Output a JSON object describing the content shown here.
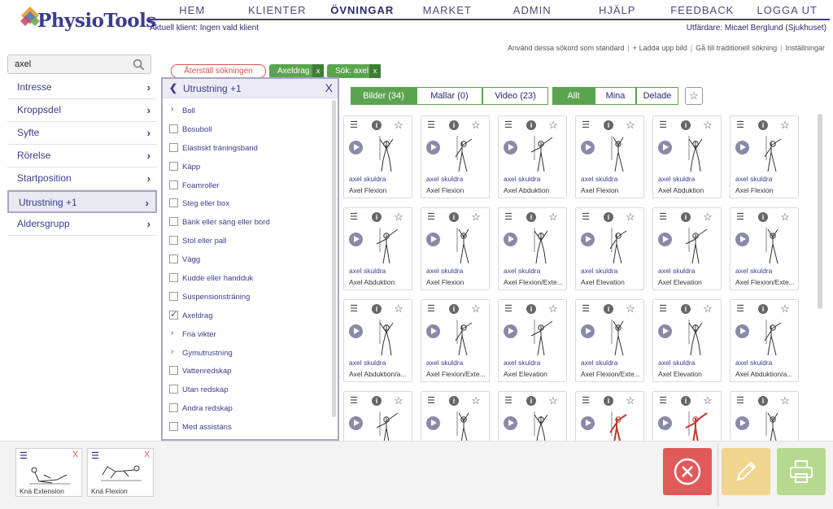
{
  "logo": {
    "text": "PhysioTools"
  },
  "nav": [
    {
      "label": "HEM",
      "active": false
    },
    {
      "label": "KLIENTER",
      "active": false
    },
    {
      "label": "ÖVNINGAR",
      "active": true
    },
    {
      "label": "MARKET",
      "active": false
    },
    {
      "label": "ADMIN",
      "active": false
    },
    {
      "label": "HJÄLP",
      "active": false
    },
    {
      "label": "FEEDBACK",
      "active": false
    },
    {
      "label": "LOGGA UT",
      "active": false
    }
  ],
  "client_info": "Aktuell klient: Ingen vald klient",
  "author_info": "Utfärdare: Micael Berglund (Sjukhuset)",
  "toolbar_links": [
    "Använd dessa sökord som standard",
    "+ Ladda upp bild",
    "Gå till traditionell sökning",
    "Inställningar"
  ],
  "search": {
    "value": "axel"
  },
  "filters": [
    {
      "label": "Intresse",
      "selected": false
    },
    {
      "label": "Kroppsdel",
      "selected": false
    },
    {
      "label": "Syfte",
      "selected": false
    },
    {
      "label": "Rörelse",
      "selected": false
    },
    {
      "label": "Startposition",
      "selected": false
    },
    {
      "label": "Utrustning  +1",
      "selected": true
    },
    {
      "label": "Aldersgrupp",
      "selected": false
    }
  ],
  "active_filters": {
    "reset_label": "Återställ sökningen",
    "tags": [
      {
        "label": "Axeldrag",
        "x": "x"
      },
      {
        "label": "Sök: axel",
        "x": "x"
      }
    ]
  },
  "equipment_panel": {
    "title": "Utrustning  +1",
    "close": "X",
    "items": [
      {
        "label": "Boll",
        "kind": "group",
        "checked": false
      },
      {
        "label": "Bosuboll",
        "kind": "check",
        "checked": false
      },
      {
        "label": "Elastiskt träningsband",
        "kind": "check",
        "checked": false
      },
      {
        "label": "Käpp",
        "kind": "check",
        "checked": false
      },
      {
        "label": "Foamroller",
        "kind": "check",
        "checked": false
      },
      {
        "label": "Steg eller box",
        "kind": "check",
        "checked": false
      },
      {
        "label": "Bänk eller säng eller bord",
        "kind": "check",
        "checked": false
      },
      {
        "label": "Stol eller pall",
        "kind": "check",
        "checked": false
      },
      {
        "label": "Vägg",
        "kind": "check",
        "checked": false
      },
      {
        "label": "Kudde eller handduk",
        "kind": "check",
        "checked": false
      },
      {
        "label": "Suspensionsträning",
        "kind": "check",
        "checked": false
      },
      {
        "label": "Axeldrag",
        "kind": "check",
        "checked": true
      },
      {
        "label": "Fria vikter",
        "kind": "group",
        "checked": false
      },
      {
        "label": "Gymutrustning",
        "kind": "group",
        "checked": false
      },
      {
        "label": "Vattenredskap",
        "kind": "check",
        "checked": false
      },
      {
        "label": "Utan redskap",
        "kind": "check",
        "checked": false
      },
      {
        "label": "Andra redskap",
        "kind": "check",
        "checked": false
      },
      {
        "label": "Med assistans",
        "kind": "check",
        "checked": false
      }
    ]
  },
  "content_tabs": [
    {
      "label": "Bilder (34)",
      "active": true
    },
    {
      "label": "Mallar (0)",
      "active": false
    },
    {
      "label": "Video (23)",
      "active": false
    }
  ],
  "owner_tabs": [
    {
      "label": "Allt",
      "active": true
    },
    {
      "label": "Mina",
      "active": false
    },
    {
      "label": "Delade",
      "active": false
    }
  ],
  "exercises": [
    {
      "category": "axel skuldra",
      "name": "Axel Flexion"
    },
    {
      "category": "axel skuldra",
      "name": "Axel Flexion"
    },
    {
      "category": "axel skuldra",
      "name": "Axel Abduktion"
    },
    {
      "category": "axel skuldra",
      "name": "Axel Flexion"
    },
    {
      "category": "axel skuldra",
      "name": "Axel Abduktion"
    },
    {
      "category": "axel skuldra",
      "name": "Axel Flexion"
    },
    {
      "category": "axel skuldra",
      "name": "Axel Abduktion"
    },
    {
      "category": "axel skuldra",
      "name": "Axel Flexion"
    },
    {
      "category": "axel skuldra",
      "name": "Axel Flexion/Exte..."
    },
    {
      "category": "axel skuldra",
      "name": "Axel Elevation"
    },
    {
      "category": "axel skuldra",
      "name": "Axel Elevation"
    },
    {
      "category": "axel skuldra",
      "name": "Axel Flexion/Exte..."
    },
    {
      "category": "axel skuldra",
      "name": "Axel Abduktion/a..."
    },
    {
      "category": "axel skuldra",
      "name": "Axel Flexion/Exte..."
    },
    {
      "category": "axel skuldra",
      "name": "Axel Elevation"
    },
    {
      "category": "axel skuldra",
      "name": "Axel Flexion/Exte..."
    },
    {
      "category": "axel skuldra",
      "name": "Axel Elevation"
    },
    {
      "category": "axel skuldra",
      "name": "Axel Abduktion/a..."
    },
    {
      "category": "",
      "name": ""
    },
    {
      "category": "",
      "name": ""
    },
    {
      "category": "",
      "name": ""
    },
    {
      "category": "",
      "name": ""
    },
    {
      "category": "",
      "name": ""
    },
    {
      "category": "",
      "name": ""
    }
  ],
  "tray": [
    {
      "name": "Knä Extension",
      "remove": "X"
    },
    {
      "name": "Knä Flexion",
      "remove": "X"
    }
  ],
  "icons": {
    "search": "search-icon",
    "menu": "hamburger-icon",
    "info": "info-icon",
    "star": "star-icon",
    "play": "play-icon",
    "clear": "clear-icon",
    "edit": "pencil-icon",
    "print": "printer-icon"
  },
  "colors": {
    "brand": "#3c3c8e",
    "green": "#5ba44f",
    "red": "#e05a5a",
    "yellow": "#f0d58e",
    "light_green": "#b7d98f"
  }
}
